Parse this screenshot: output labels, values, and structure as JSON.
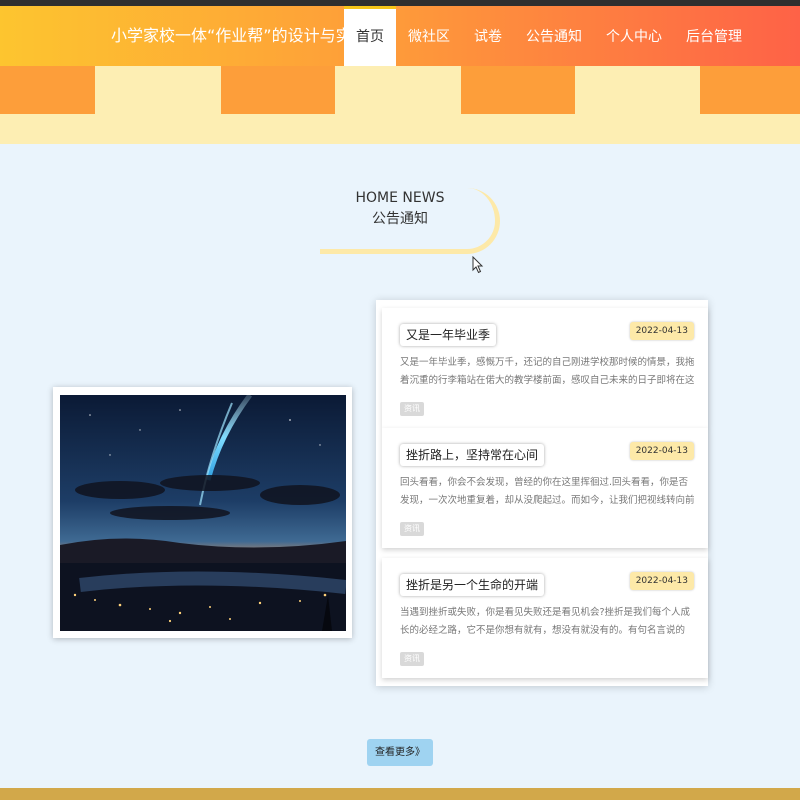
{
  "header": {
    "title": "小学家校一体“作业帮”的设计与实现",
    "nav": [
      {
        "label": "首页",
        "active": true
      },
      {
        "label": "微社区"
      },
      {
        "label": "试卷"
      },
      {
        "label": "公告通知"
      },
      {
        "label": "个人中心"
      },
      {
        "label": "后台管理"
      }
    ]
  },
  "section": {
    "title_en": "HOME NEWS",
    "title_cn": "公告通知"
  },
  "news": [
    {
      "title": "又是一年毕业季",
      "date": "2022-04-13",
      "summary": "又是一年毕业季，感慨万千，还记的自己刚进学校那时候的情景，我拖着沉重的行李箱站在偌大的教学楼前面，感叹自己未来的日子即将在这个陌生的校园里...",
      "tag": "资讯"
    },
    {
      "title": "挫折路上，坚持常在心间",
      "date": "2022-04-13",
      "summary": "回头看看，你会不会发现，曾经的你在这里挥徊过.回头看看，你是否发现，一次次地重复着，却从没爬起过。而如今，让我们把视线转向前方，那一道道金...",
      "tag": "资讯"
    },
    {
      "title": "挫折是另一个生命的开端",
      "date": "2022-04-13",
      "summary": "当遇到挫折或失败，你是看见失败还是看见机会?挫折是我们每个人成长的必经之路，它不是你想有就有，想没有就没有的。有句名言说的好，如果你想一生...",
      "tag": "资讯"
    }
  ],
  "more_button": "查看更多》",
  "colors": {
    "header_start": "#fdc52f",
    "header_mid": "#fe9a3a",
    "header_end": "#fe6247",
    "orange_block": "#fd9e3a",
    "cream": "#fdeeb3",
    "page_bg": "#eaf4fc",
    "button_bg": "#9fd3f1",
    "footer": "#d2a84a"
  }
}
